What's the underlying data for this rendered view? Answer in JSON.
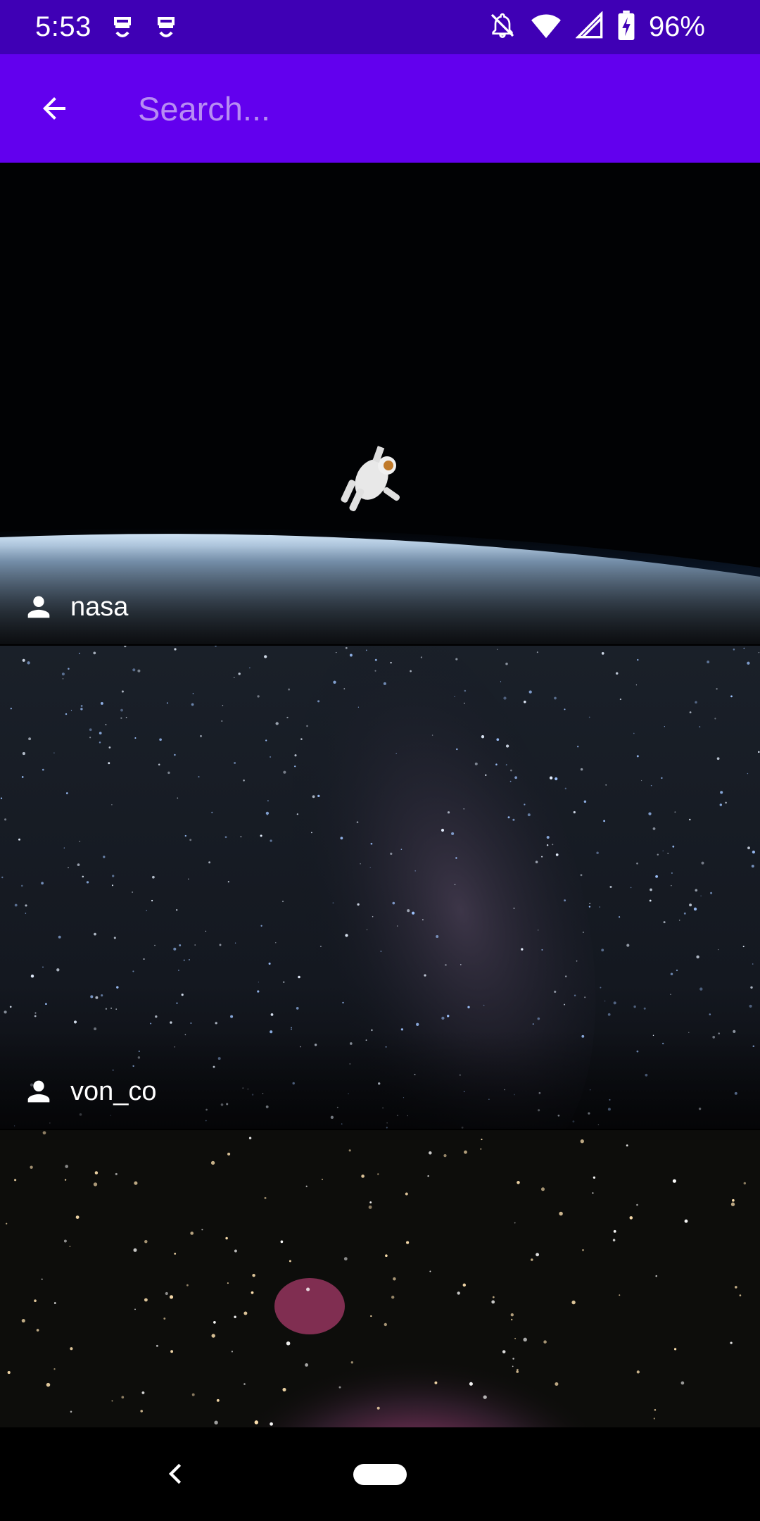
{
  "status_bar": {
    "time": "5:53",
    "left_icons": [
      "notification-app-icon",
      "notification-app-icon"
    ],
    "right_icons": [
      "bell-off-icon",
      "wifi-icon",
      "signal-icon",
      "battery-charging-icon"
    ],
    "battery_percent": "96%",
    "background": "#3f00b5"
  },
  "app_bar": {
    "back_icon": "arrow-back-icon",
    "search": {
      "value": "",
      "placeholder": "Search..."
    },
    "background": "#6200ee"
  },
  "photos": [
    {
      "author": "nasa",
      "author_icon": "person-icon",
      "subject": "astronaut-over-earth"
    },
    {
      "author": "von_co",
      "author_icon": "person-icon",
      "subject": "milky-way"
    },
    {
      "author": "",
      "author_icon": "person-icon",
      "subject": "orion-nebula"
    }
  ],
  "nav_bar": {
    "back_icon": "chevron-left-icon",
    "home_icon": "home-pill-icon"
  }
}
